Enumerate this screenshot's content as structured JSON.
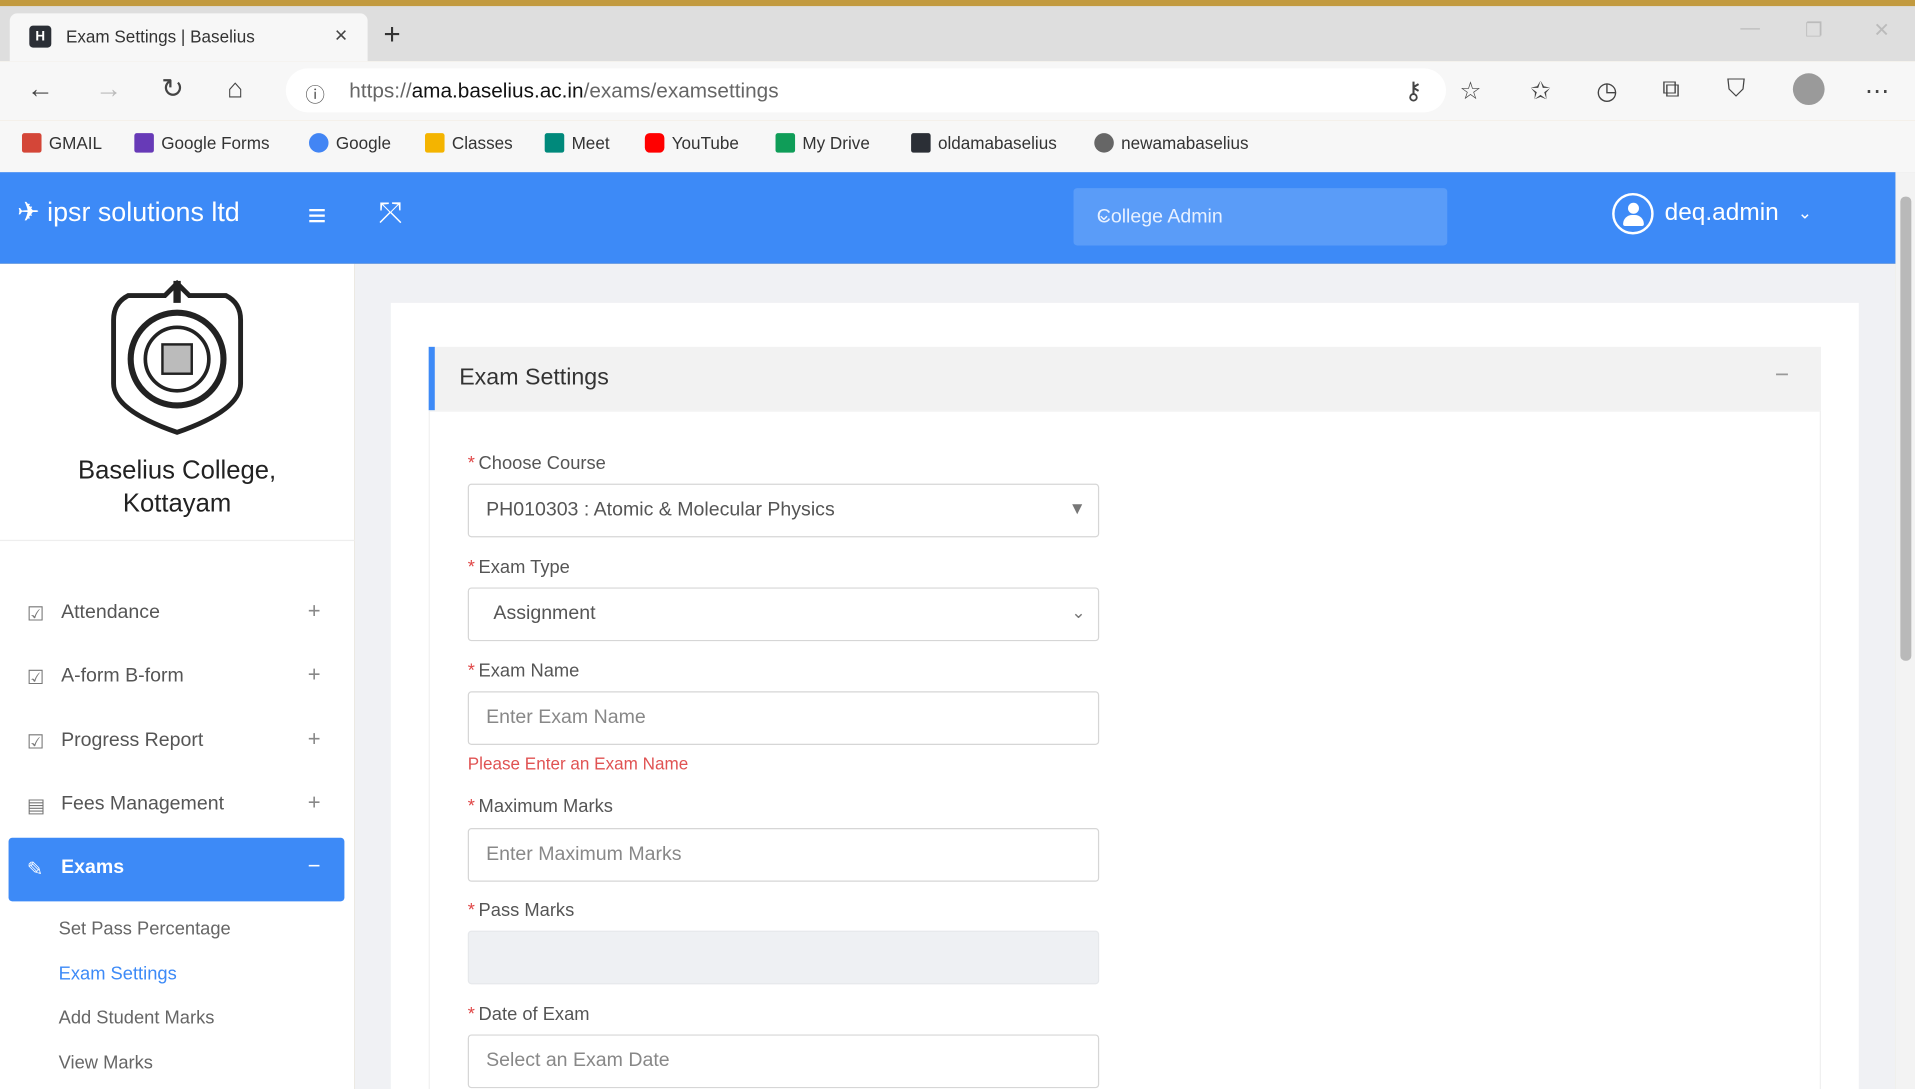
{
  "browser": {
    "tab_title": "Exam Settings | Baselius",
    "tab_close": "×",
    "new_tab": "+",
    "url_prefix": "https://",
    "url_host": "ama.baselius.ac.in",
    "url_path": "/exams/examsettings"
  },
  "bookmarks": [
    {
      "label": "GMAIL",
      "color": "#d44638"
    },
    {
      "label": "Google Forms",
      "color": "#673ab7"
    },
    {
      "label": "Google",
      "color": "#4285f4"
    },
    {
      "label": "Classes",
      "color": "#f4b400"
    },
    {
      "label": "Meet",
      "color": "#00897b"
    },
    {
      "label": "YouTube",
      "color": "#ff0000"
    },
    {
      "label": "My Drive",
      "color": "#0f9d58"
    },
    {
      "label": "oldamabaselius",
      "color": "#2b2f36"
    },
    {
      "label": "newamabaselius",
      "color": "#666666"
    }
  ],
  "app": {
    "brand": "ipsr solutions ltd",
    "role_selected": "College Admin",
    "username": "deq.admin",
    "accent": "#3d8af7"
  },
  "sidebar": {
    "college_name_line1": "Baselius College,",
    "college_name_line2": "Kottayam",
    "items": [
      {
        "label": "Attendance"
      },
      {
        "label": "A-form B-form"
      },
      {
        "label": "Progress Report"
      },
      {
        "label": "Fees Management"
      },
      {
        "label": "Exams"
      }
    ],
    "exams_sub": [
      {
        "label": "Set Pass Percentage"
      },
      {
        "label": "Exam Settings"
      },
      {
        "label": "Add Student Marks"
      },
      {
        "label": "View Marks"
      }
    ]
  },
  "panel": {
    "title": "Exam Settings",
    "collapse": "−"
  },
  "form": {
    "course_label": "Choose Course",
    "course_value": "PH010303 : Atomic & Molecular Physics",
    "type_label": "Exam Type",
    "type_value": "Assignment",
    "name_label": "Exam Name",
    "name_placeholder": "Enter Exam Name",
    "name_error": "Please Enter an Exam Name",
    "max_label": "Maximum Marks",
    "max_placeholder": "Enter Maximum Marks",
    "pass_label": "Pass Marks",
    "date_label": "Date of Exam",
    "date_placeholder": "Select an Exam Date"
  }
}
